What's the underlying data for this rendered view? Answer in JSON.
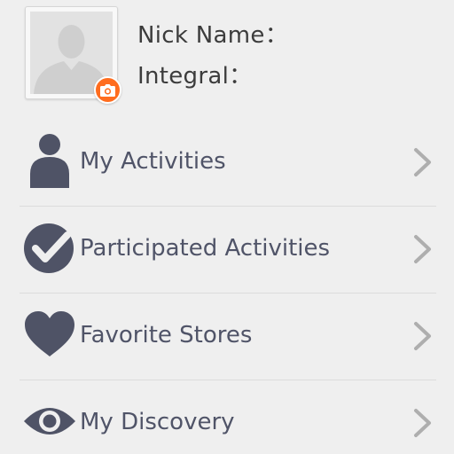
{
  "profile": {
    "nickname_label": "Nick Name：",
    "integral_label": "Integral：",
    "avatar_icon": "default-user-silhouette",
    "camera_icon": "camera-icon"
  },
  "menu": {
    "items": [
      {
        "label": "My Activities",
        "icon": "person-icon"
      },
      {
        "label": "Participated Activities",
        "icon": "check-circle-icon"
      },
      {
        "label": "Favorite Stores",
        "icon": "heart-icon"
      },
      {
        "label": "My Discovery",
        "icon": "eye-icon"
      }
    ],
    "chevron_icon": "chevron-right-icon"
  },
  "colors": {
    "background": "#efefef",
    "icon": "#4f5366",
    "text": "#505468",
    "accent": "#ff6d1f",
    "chevron": "#aeaeae",
    "divider": "#dcdcdc"
  }
}
